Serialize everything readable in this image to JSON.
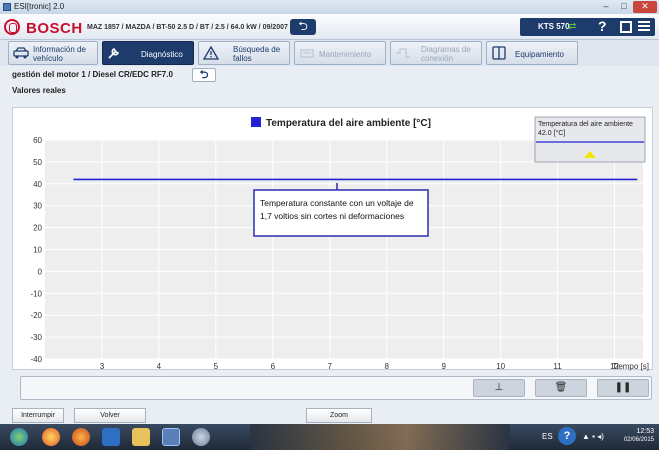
{
  "window": {
    "title": "ESI[tronic] 2.0"
  },
  "header": {
    "brand": "BOSCH",
    "vehicle": "MAZ 1857 / MAZDA / BT-50 2.5 D / BT / 2.5 / 64.0 kW / 09/2007 - / WL",
    "device": {
      "label": "KTS 570",
      "help": "?"
    }
  },
  "tabs": [
    {
      "label": "Información de vehículo",
      "state": "normal",
      "icon": "car-info-icon"
    },
    {
      "label": "Diagnóstico",
      "state": "active",
      "icon": "diagnosis-icon"
    },
    {
      "label": "Búsqueda de fallos",
      "state": "normal",
      "icon": "warning-triangle-icon"
    },
    {
      "label": "Mantenimiento",
      "state": "disabled",
      "icon": "maintenance-icon"
    },
    {
      "label": "Diagramas de conexión",
      "state": "disabled",
      "icon": "wiring-diagram-icon"
    },
    {
      "label": "Equipamiento",
      "state": "normal",
      "icon": "equipment-icon"
    }
  ],
  "breadcrumb": "gestión del motor 1 / Diesel CR/EDC RF7.0",
  "section_title": "Valores reales",
  "chart_data": {
    "type": "line",
    "title": "Temperatura del aire ambiente [°C]",
    "xlabel": "Tiempo [s]",
    "ylabel": "",
    "x_ticks": [
      3,
      4,
      5,
      6,
      7,
      8,
      9,
      10,
      11,
      12
    ],
    "y_ticks": [
      60,
      50,
      40,
      30,
      20,
      10,
      0,
      -10,
      -20,
      -30,
      -40
    ],
    "xlim": [
      2,
      12.5
    ],
    "ylim": [
      -40,
      60
    ],
    "grid": true,
    "series": [
      {
        "name": "Temperatura del aire ambiente [°C]",
        "color": "#2323d6",
        "x": [
          2.5,
          12.4
        ],
        "y": [
          42,
          42
        ]
      }
    ],
    "live_readout": {
      "label": "Temperatura del aire ambiente",
      "value": "42.0 [°C]"
    },
    "annotation": "Temperatura constante con un voltaje de 1,7 voltios sin cortes ni deformaciones"
  },
  "chart_toolbar": {
    "buttons": [
      {
        "name": "zoom-fit-button",
        "glyph": "⊥"
      },
      {
        "name": "delete-button",
        "glyph": "🗑"
      },
      {
        "name": "pause-button",
        "glyph": "❚❚"
      }
    ]
  },
  "footer": {
    "interrupt": "Interrumpir",
    "back": "Volver",
    "zoom": "Zoom"
  },
  "taskbar": {
    "lang": "ES",
    "time": "12:53",
    "date": "02/06/2015"
  },
  "colors": {
    "brand_red": "#c8102e",
    "nav_blue": "#1d3b6b",
    "series_blue": "#2323d6",
    "annotation_border": "#2b2bb0",
    "readout_arrow": "#f2e600"
  }
}
